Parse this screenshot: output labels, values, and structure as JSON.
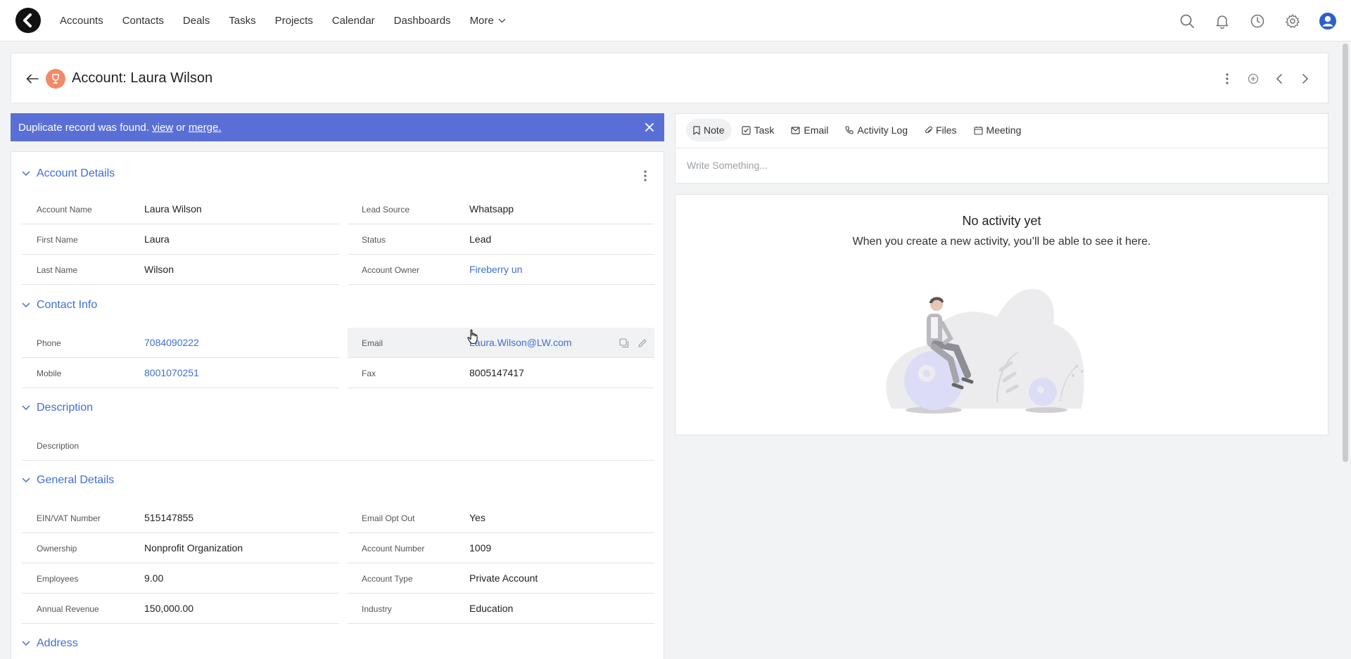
{
  "nav": {
    "items": [
      "Accounts",
      "Contacts",
      "Deals",
      "Tasks",
      "Projects",
      "Calendar",
      "Dashboards"
    ],
    "more_label": "More"
  },
  "header": {
    "title": "Account: Laura Wilson"
  },
  "banner": {
    "text": "Duplicate record was found.",
    "view_link": "view",
    "or_text": "or",
    "merge_link": "merge."
  },
  "sections": {
    "account_details": "Account Details",
    "contact_info": "Contact Info",
    "description": "Description",
    "general_details": "General Details",
    "address": "Address"
  },
  "account_details": {
    "account_name": {
      "label": "Account Name",
      "value": "Laura Wilson"
    },
    "first_name": {
      "label": "First Name",
      "value": "Laura"
    },
    "last_name": {
      "label": "Last Name",
      "value": "Wilson"
    },
    "lead_source": {
      "label": "Lead Source",
      "value": "Whatsapp"
    },
    "status": {
      "label": "Status",
      "value": "Lead"
    },
    "account_owner": {
      "label": "Account Owner",
      "value": "Fireberry un"
    }
  },
  "contact_info": {
    "phone": {
      "label": "Phone",
      "value": "7084090222"
    },
    "mobile": {
      "label": "Mobile",
      "value": "8001070251"
    },
    "email": {
      "label": "Email",
      "value": "Laura.Wilson@LW.com"
    },
    "fax": {
      "label": "Fax",
      "value": "8005147417"
    }
  },
  "description": {
    "label": "Description",
    "value": ""
  },
  "general_details": {
    "ein": {
      "label": "EIN/VAT Number",
      "value": "515147855"
    },
    "ownership": {
      "label": "Ownership",
      "value": "Nonprofit Organization"
    },
    "employees": {
      "label": "Employees",
      "value": "9.00"
    },
    "annual_revenue": {
      "label": "Annual Revenue",
      "value": "150,000.00"
    },
    "email_opt_out": {
      "label": "Email Opt Out",
      "value": "Yes"
    },
    "account_number": {
      "label": "Account Number",
      "value": "1009"
    },
    "account_type": {
      "label": "Account Type",
      "value": "Private Account"
    },
    "industry": {
      "label": "Industry",
      "value": "Education"
    }
  },
  "composer": {
    "tabs": [
      "Note",
      "Task",
      "Email",
      "Activity Log",
      "Files",
      "Meeting"
    ],
    "placeholder": "Write Something..."
  },
  "activity": {
    "empty_title": "No activity yet",
    "empty_subtitle": "When you create a new activity, you’ll be able to see it here."
  },
  "colors": {
    "accent": "#3f6fd1",
    "banner": "#5a6fd6",
    "account_badge": "#f28a6a"
  }
}
